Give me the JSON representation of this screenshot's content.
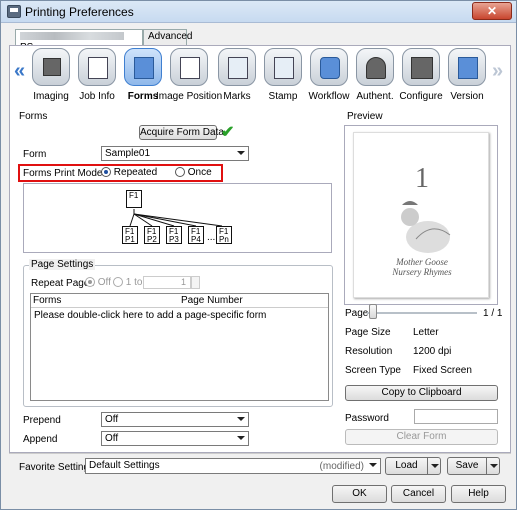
{
  "window": {
    "title": "Printing Preferences",
    "close_symbol": "✕"
  },
  "tabs": [
    {
      "label": "PS"
    },
    {
      "label": "Advanced"
    }
  ],
  "ribbon": {
    "left_arrow": "«",
    "right_arrow": "»",
    "items": [
      {
        "label": "Imaging",
        "icon": "imaging-icon"
      },
      {
        "label": "Job Info",
        "icon": "job-info-icon"
      },
      {
        "label": "Forms",
        "icon": "forms-icon",
        "active": true
      },
      {
        "label": "Image Position",
        "icon": "image-position-icon"
      },
      {
        "label": "Marks",
        "icon": "marks-icon"
      },
      {
        "label": "Stamp",
        "icon": "stamp-icon"
      },
      {
        "label": "Workflow",
        "icon": "workflow-icon"
      },
      {
        "label": "Authent.",
        "icon": "authentication-icon"
      },
      {
        "label": "Configure",
        "icon": "configure-icon"
      },
      {
        "label": "Version",
        "icon": "version-icon"
      }
    ]
  },
  "forms": {
    "section_label": "Forms",
    "acquire_button": "Acquire Form Data",
    "form_label": "Form",
    "form_value": "Sample01",
    "print_mode_label": "Forms Print Mode",
    "mode_repeated": "Repeated",
    "mode_once": "Once",
    "diagram": {
      "top": "F1",
      "pages": [
        "P1",
        "P2",
        "P3",
        "P4",
        "Pn"
      ],
      "ellipsis": "..."
    }
  },
  "page_settings": {
    "label": "Page Settings",
    "repeat_label": "Repeat Pages",
    "off": "Off",
    "range_prefix": "1 to",
    "range_value": "1",
    "col_forms": "Forms",
    "col_page_number": "Page Number",
    "hint": "Please double-click here to add a page-specific form"
  },
  "prepend": {
    "label": "Prepend",
    "value": "Off"
  },
  "append": {
    "label": "Append",
    "value": "Off"
  },
  "preview": {
    "label": "Preview",
    "page_label": "Page",
    "page_count": "1 / 1",
    "page_number_mark": "1",
    "preview_text_1": "Mother Goose",
    "preview_text_2": "Nursery Rhymes",
    "page_size_label": "Page Size",
    "page_size_value": "Letter",
    "resolution_label": "Resolution",
    "resolution_value": "1200 dpi",
    "screen_type_label": "Screen Type",
    "screen_type_value": "Fixed Screen",
    "copy_button": "Copy to Clipboard",
    "password_label": "Password",
    "clear_form_button": "Clear Form"
  },
  "favorite": {
    "label": "Favorite Setting",
    "value": "Default Settings",
    "modified": "(modified)",
    "load_button": "Load",
    "save_button": "Save"
  },
  "footer": {
    "ok": "OK",
    "cancel": "Cancel",
    "help": "Help"
  }
}
